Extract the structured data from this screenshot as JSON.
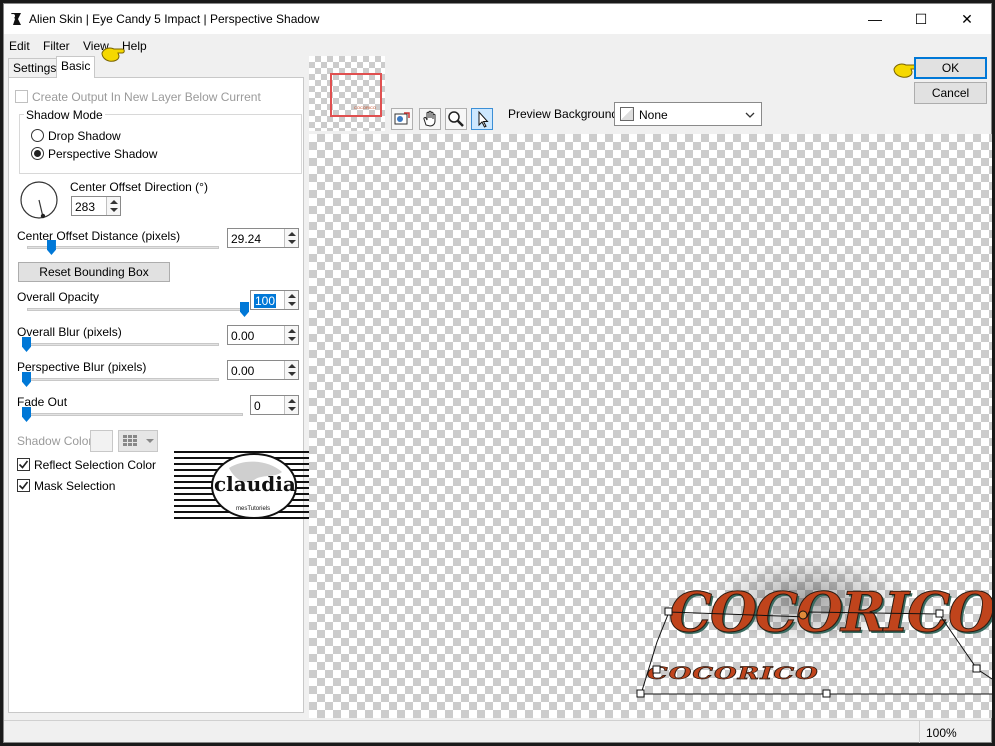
{
  "window": {
    "title": "Alien Skin | Eye Candy 5 Impact | Perspective Shadow",
    "minimize_glyph": "—",
    "maximize_glyph": "☐",
    "close_glyph": "✕"
  },
  "menu": {
    "items": [
      "Edit",
      "Filter",
      "View",
      "Help"
    ]
  },
  "tabs": [
    "Settings",
    "Basic"
  ],
  "basic": {
    "create_output_label": "Create Output In New Layer Below Current",
    "shadow_mode_label": "Shadow Mode",
    "drop_shadow_label": "Drop Shadow",
    "perspective_shadow_label": "Perspective Shadow",
    "center_offset_direction_label": "Center Offset Direction (°)",
    "center_offset_direction_value": "283",
    "center_offset_distance_label": "Center Offset Distance (pixels)",
    "center_offset_distance_value": "29.24",
    "reset_bounding_box_label": "Reset Bounding Box",
    "overall_opacity_label": "Overall Opacity",
    "overall_opacity_value": "100",
    "overall_blur_label": "Overall Blur (pixels)",
    "overall_blur_value": "0.00",
    "perspective_blur_label": "Perspective Blur (pixels)",
    "perspective_blur_value": "0.00",
    "fade_out_label": "Fade Out",
    "fade_out_value": "0",
    "shadow_color_label": "Shadow Color",
    "reflect_selection_color_label": "Reflect Selection Color",
    "mask_selection_label": "Mask Selection"
  },
  "slider_levels": {
    "center_offset_distance": 0.13,
    "overall_opacity": 1.0,
    "overall_blur": 0.0,
    "perspective_blur": 0.0,
    "fade_out": 0.0
  },
  "watermark": {
    "text": "claudia",
    "subtext": "mesTutoriels"
  },
  "actions": {
    "ok_label": "OK",
    "cancel_label": "Cancel"
  },
  "preview": {
    "background_label": "Preview Background:",
    "background_value": "None",
    "zoom": "100%",
    "main_text": "COCORICO",
    "shadow_text": "COCORICO",
    "thumbnail_text": "COCORICO"
  },
  "colors": {
    "accent": "#0078d7",
    "ok_border": "#0078d7",
    "text_main": "#c0441c",
    "text_shade": "#3a6b60",
    "pointer": "#f5d800"
  }
}
